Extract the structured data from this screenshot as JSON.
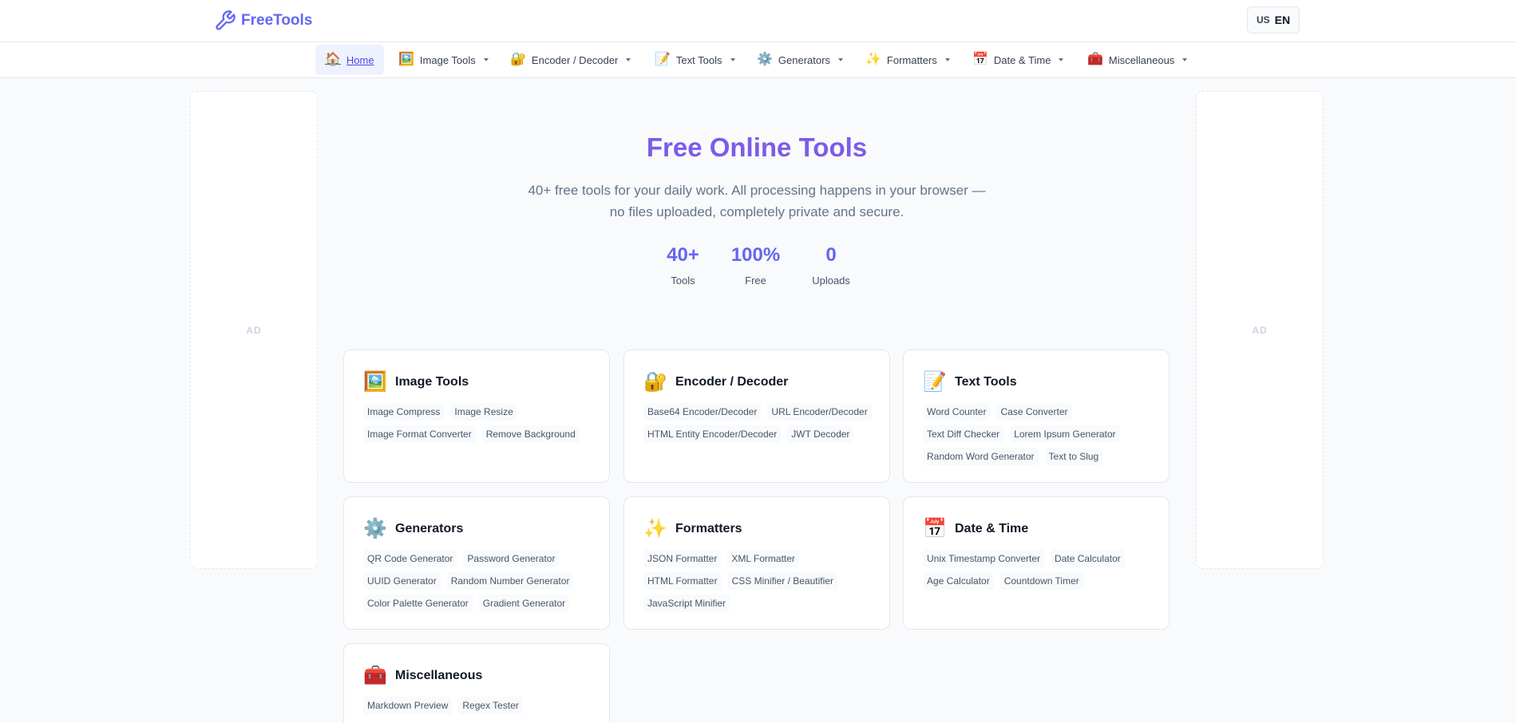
{
  "header": {
    "logo_text": "FreeTools",
    "lang_flag": "US",
    "lang_code": "EN"
  },
  "nav": [
    {
      "label": "Home",
      "icon": "🏠",
      "icon_name": "house-icon",
      "active": true,
      "dropdown": false
    },
    {
      "label": "Image Tools",
      "icon": "🖼️",
      "icon_name": "framed-picture-icon",
      "active": false,
      "dropdown": true
    },
    {
      "label": "Encoder / Decoder",
      "icon": "🔐",
      "icon_name": "lock-key-icon",
      "active": false,
      "dropdown": true
    },
    {
      "label": "Text Tools",
      "icon": "📝",
      "icon_name": "memo-icon",
      "active": false,
      "dropdown": true
    },
    {
      "label": "Generators",
      "icon": "⚙️",
      "icon_name": "gear-icon",
      "active": false,
      "dropdown": true
    },
    {
      "label": "Formatters",
      "icon": "✨",
      "icon_name": "sparkles-icon",
      "active": false,
      "dropdown": true
    },
    {
      "label": "Date & Time",
      "icon": "📅",
      "icon_name": "calendar-icon",
      "active": false,
      "dropdown": true
    },
    {
      "label": "Miscellaneous",
      "icon": "🧰",
      "icon_name": "toolbox-icon",
      "active": false,
      "dropdown": true
    }
  ],
  "ads": {
    "left_label": "AD",
    "right_label": "AD"
  },
  "hero": {
    "title": "Free Online Tools",
    "subtitle": "40+ free tools for your daily work. All processing happens in your browser — no files uploaded, completely private and secure."
  },
  "stats": [
    {
      "value": "40+",
      "label": "Tools"
    },
    {
      "value": "100%",
      "label": "Free"
    },
    {
      "value": "0",
      "label": "Uploads"
    }
  ],
  "categories": [
    {
      "title": "Image Tools",
      "icon": "🖼️",
      "icon_name": "framed-picture-icon",
      "tools": [
        "Image Compress",
        "Image Resize",
        "Image Format Converter",
        "Remove Background"
      ]
    },
    {
      "title": "Encoder / Decoder",
      "icon": "🔐",
      "icon_name": "lock-key-icon",
      "tools": [
        "Base64 Encoder/Decoder",
        "URL Encoder/Decoder",
        "HTML Entity Encoder/Decoder",
        "JWT Decoder"
      ]
    },
    {
      "title": "Text Tools",
      "icon": "📝",
      "icon_name": "memo-icon",
      "tools": [
        "Word Counter",
        "Case Converter",
        "Text Diff Checker",
        "Lorem Ipsum Generator",
        "Random Word Generator",
        "Text to Slug"
      ]
    },
    {
      "title": "Generators",
      "icon": "⚙️",
      "icon_name": "gear-icon",
      "tools": [
        "QR Code Generator",
        "Password Generator",
        "UUID Generator",
        "Random Number Generator",
        "Color Palette Generator",
        "Gradient Generator"
      ]
    },
    {
      "title": "Formatters",
      "icon": "✨",
      "icon_name": "sparkles-icon",
      "tools": [
        "JSON Formatter",
        "XML Formatter",
        "HTML Formatter",
        "CSS Minifier / Beautifier",
        "JavaScript Minifier"
      ]
    },
    {
      "title": "Date & Time",
      "icon": "📅",
      "icon_name": "calendar-icon",
      "tools": [
        "Unix Timestamp Converter",
        "Date Calculator",
        "Age Calculator",
        "Countdown Timer"
      ]
    },
    {
      "title": "Miscellaneous",
      "icon": "🧰",
      "icon_name": "toolbox-icon",
      "tools": [
        "Markdown Preview",
        "Regex Tester"
      ]
    }
  ]
}
